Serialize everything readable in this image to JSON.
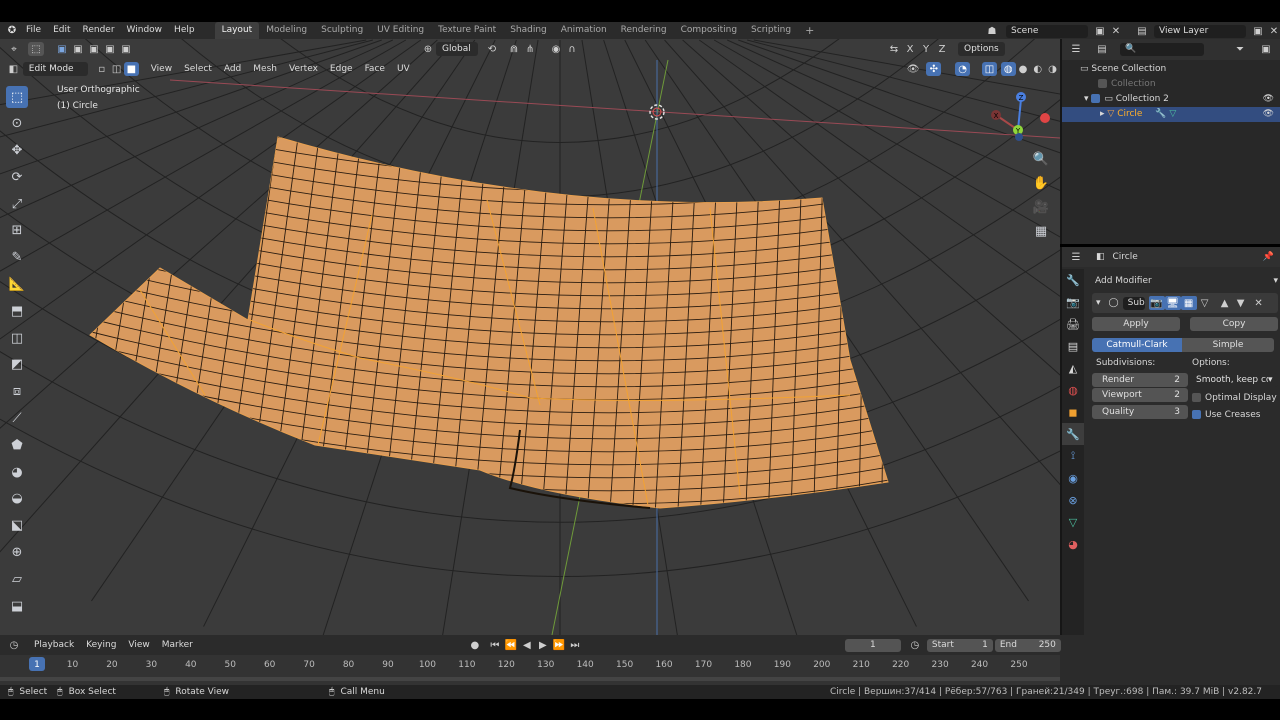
{
  "menu": {
    "items": [
      "File",
      "Edit",
      "Render",
      "Window",
      "Help"
    ]
  },
  "workspaces": {
    "tabs": [
      "Layout",
      "Modeling",
      "Sculpting",
      "UV Editing",
      "Texture Paint",
      "Shading",
      "Animation",
      "Rendering",
      "Compositing",
      "Scripting"
    ],
    "active": "Layout",
    "add_label": "+"
  },
  "scene": {
    "name": "Scene",
    "view_layer": "View Layer"
  },
  "viewport_header": {
    "transform_orientation": "Global",
    "options_label": "Options",
    "mode": "Edit Mode",
    "menus": [
      "View",
      "Select",
      "Add",
      "Mesh",
      "Vertex",
      "Edge",
      "Face",
      "UV"
    ],
    "axes": [
      "X",
      "Y",
      "Z"
    ]
  },
  "viewport": {
    "view_name": "User Orthographic",
    "object_name": "(1) Circle",
    "gizmo": {
      "x": "X",
      "y": "Y",
      "z": "Z"
    }
  },
  "outliner": {
    "root": "Scene Collection",
    "items": [
      {
        "name": "Collection",
        "dimmed": true
      },
      {
        "name": "Collection 2",
        "dimmed": false
      },
      {
        "name": "Circle",
        "selected": true
      }
    ]
  },
  "properties": {
    "object_name": "Circle",
    "add_modifier": "Add Modifier",
    "modifier_name": "Sub",
    "apply_label": "Apply",
    "copy_label": "Copy",
    "type_active": "Catmull-Clark",
    "type_other": "Simple",
    "subdivisions_label": "Subdivisions:",
    "options_label": "Options:",
    "render": {
      "label": "Render",
      "value": "2"
    },
    "viewport": {
      "label": "Viewport",
      "value": "2"
    },
    "quality": {
      "label": "Quality",
      "value": "3"
    },
    "uv_smooth": "Smooth, keep cor...",
    "optimal_display": "Optimal Display",
    "use_creases": "Use Creases"
  },
  "timeline": {
    "menus": [
      "Playback",
      "Keying",
      "View",
      "Marker"
    ],
    "current_frame": "1",
    "start_label": "Start",
    "start_value": "1",
    "end_label": "End",
    "end_value": "250",
    "ticks": [
      "1",
      "10",
      "20",
      "30",
      "40",
      "50",
      "60",
      "70",
      "80",
      "90",
      "100",
      "110",
      "120",
      "130",
      "140",
      "150",
      "160",
      "170",
      "180",
      "190",
      "200",
      "210",
      "220",
      "230",
      "240",
      "250"
    ]
  },
  "statusbar": {
    "select": "Select",
    "box_select": "Box Select",
    "rotate_view": "Rotate View",
    "call_menu": "Call Menu",
    "stats": "Circle | Вершин:37/414 | Рёбер:57/763 | Граней:21/349 | Треуг.:698 | Пам.: 39.7 MiB | v2.82.7"
  },
  "colors": {
    "selected_face": "#d99a5f",
    "accent": "#4772b3",
    "viewport_bg": "#3b3b3b",
    "panel_bg": "#2b2b2b"
  }
}
